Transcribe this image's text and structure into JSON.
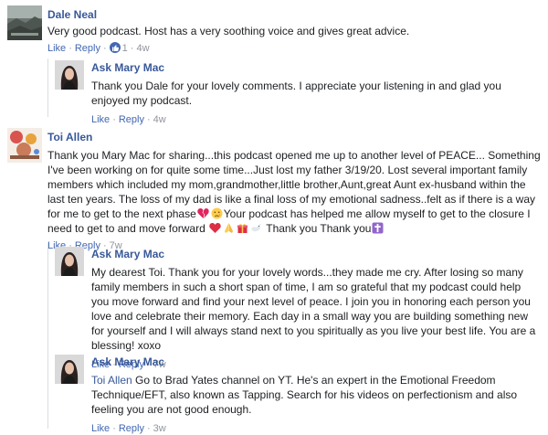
{
  "comments": [
    {
      "author": "Dale Neal",
      "text": "Very good podcast. Host has a very soothing voice and gives great advice.",
      "actions": {
        "like": "Like",
        "reply": "Reply",
        "reaction_count": "1",
        "time": "4w"
      }
    },
    {
      "author": "Ask Mary Mac",
      "text": "Thank you Dale for your lovely comments. I appreciate your listening in and glad you enjoyed my podcast.",
      "actions": {
        "like": "Like",
        "reply": "Reply",
        "time": "4w"
      }
    },
    {
      "author": "Toi Allen",
      "text_part1": "Thank you Mary Mac for sharing...this podcast opened me up to another level of PEACE... Something I've been working on for quite some time...Just lost my father 3/19/20. Lost several important family members which included my mom,grandmother,little brother,Aunt,great Aunt ex-husband within the last ten years. The loss of my dad is like a final loss of my emotional sadness..felt as if there is a way for me to get to the next phase",
      "text_part2": "Your podcast has helped me allow myself to get to the closure I need to get to and move forward",
      "text_part3": " Thank you Thank you",
      "actions": {
        "like": "Like",
        "reply": "Reply",
        "time": "7w"
      }
    },
    {
      "author": "Ask Mary Mac",
      "text": "My dearest Toi. Thank you for your lovely words...they made me cry. After losing so many family members in such a short span of time, I am so grateful that my podcast could help you move forward and find your next level of peace. I join you in honoring each person you love and celebrate their memory. Each day in a small way you are building something new for yourself and I will always stand next to you spiritually as you live your best life. You are a blessing! xoxo",
      "actions": {
        "like": "Like",
        "reply": "Reply",
        "time": "7w"
      }
    },
    {
      "author": "Ask Mary Mac",
      "mention": "Toi Allen",
      "text": " Go to Brad Yates channel on YT. He's an expert in the Emotional Freedom Technique/EFT, also known as Tapping. Search for his videos on perfectionism and also feeling you are not good enough.",
      "actions": {
        "like": "Like",
        "reply": "Reply",
        "time": "3w"
      }
    }
  ],
  "colors": {
    "link": "#385898",
    "meta": "#90949c",
    "text": "#1c1e21",
    "like_blue": "#4267b2"
  },
  "icons": {
    "dale_avatar": "landscape-photo",
    "mary_avatar": "woman-portrait",
    "toi_avatar": "decorative-collage",
    "like_reaction": "thumbs-up-icon",
    "emojis_line1": [
      "broken-heart-icon",
      "crying-face-icon"
    ],
    "emojis_line2": [
      "red-heart-icon",
      "folded-hands-icon",
      "gift-icon",
      "dove-icon",
      "cross-icon"
    ]
  }
}
